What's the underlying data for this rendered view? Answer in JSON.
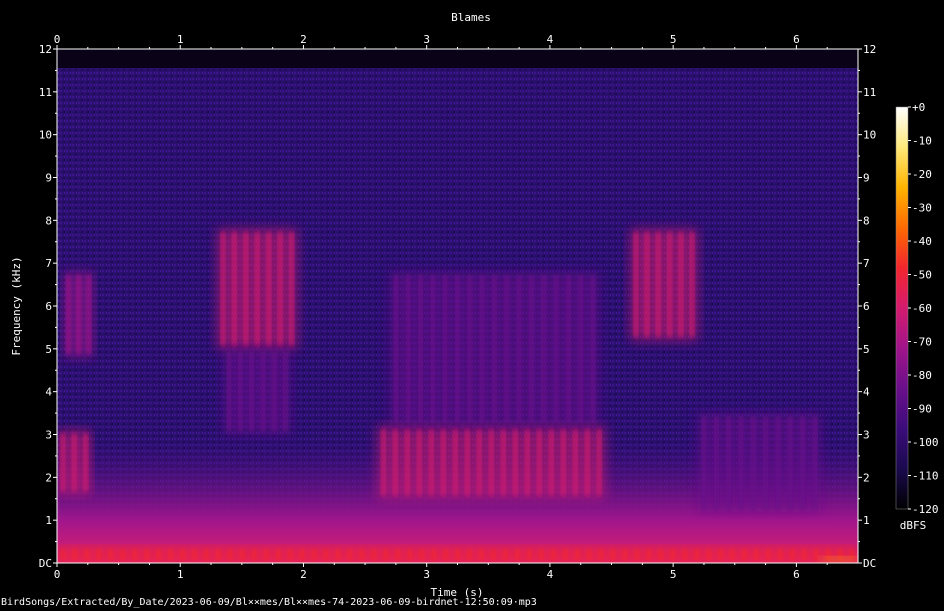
{
  "chart_data": {
    "type": "heatmap",
    "title": "Blames",
    "xlabel": "Time (s)",
    "ylabel": "Frequency (kHz)",
    "xlim": [
      0,
      6.5
    ],
    "ylim": [
      0,
      12
    ],
    "x_ticks": [
      "0",
      "1",
      "2",
      "3",
      "4",
      "5",
      "6"
    ],
    "y_ticks": [
      "DC",
      "1",
      "2",
      "3",
      "4",
      "5",
      "6",
      "7",
      "8",
      "9",
      "10",
      "11",
      "12"
    ],
    "colorbar": {
      "label": "dBFS",
      "range": [
        -120,
        0
      ],
      "ticks": [
        "+0",
        "-10",
        "-20",
        "-30",
        "-40",
        "-50",
        "-60",
        "-70",
        "-80",
        "-90",
        "-100",
        "-110",
        "-120"
      ],
      "colors": [
        "#000000",
        "#1a0a4e",
        "#3b0c7a",
        "#6a0f8a",
        "#a0148a",
        "#d41b6e",
        "#f3262e",
        "#ff6a00",
        "#ffb400",
        "#ffe97a",
        "#ffffff"
      ]
    },
    "background_color": "#2a0f6a",
    "events": [
      {
        "t_start": 0.0,
        "t_end": 0.28,
        "f_low": 1.6,
        "f_high": 3.1,
        "level_dbfs": -65
      },
      {
        "t_start": 0.05,
        "t_end": 0.3,
        "f_low": 4.8,
        "f_high": 6.8,
        "level_dbfs": -78
      },
      {
        "t_start": 1.3,
        "t_end": 1.95,
        "f_low": 5.0,
        "f_high": 7.8,
        "level_dbfs": -62
      },
      {
        "t_start": 1.35,
        "t_end": 1.9,
        "f_low": 3.0,
        "f_high": 5.0,
        "level_dbfs": -82
      },
      {
        "t_start": 2.6,
        "t_end": 4.45,
        "f_low": 1.5,
        "f_high": 3.2,
        "level_dbfs": -62
      },
      {
        "t_start": 2.7,
        "t_end": 4.4,
        "f_low": 3.2,
        "f_high": 6.8,
        "level_dbfs": -80
      },
      {
        "t_start": 4.65,
        "t_end": 5.2,
        "f_low": 5.2,
        "f_high": 7.8,
        "level_dbfs": -62
      },
      {
        "t_start": 5.2,
        "t_end": 6.2,
        "f_low": 1.2,
        "f_high": 3.5,
        "level_dbfs": -84
      },
      {
        "t_start": 0.0,
        "t_end": 6.5,
        "f_low": 0.0,
        "f_high": 0.4,
        "level_dbfs": -45
      },
      {
        "t_start": 6.2,
        "t_end": 6.5,
        "f_low": 0.0,
        "f_high": 0.15,
        "level_dbfs": -30
      }
    ]
  },
  "footer": {
    "path": "BirdSongs/Extracted/By_Date/2023-06-09/Bl××mes/Bl××mes-74-2023-06-09-birdnet-12:50:09·mp3"
  }
}
